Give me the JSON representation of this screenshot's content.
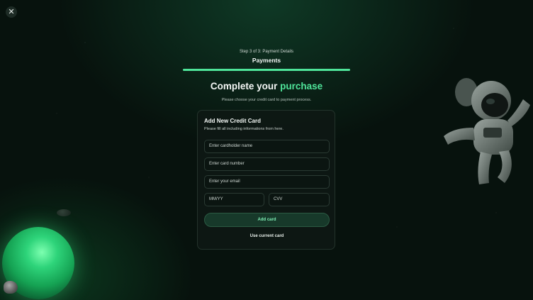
{
  "header": {
    "close_symbol": "✕",
    "step_text": "Step 3 of 3: Payment Details",
    "heading": "Payments",
    "progress_fraction": 1.0
  },
  "main": {
    "title_part1": "Complete your ",
    "title_accent": "purchase",
    "subtitle": "Please choose your credit card to payment process."
  },
  "card": {
    "title": "Add New Credit Card",
    "description": "Please fill all including informations from here.",
    "fields": {
      "cardholder_placeholder": "Enter cardholder name",
      "card_number_placeholder": "Enter card number",
      "email_placeholder": "Enter your email",
      "expiry_placeholder": "MM/YY",
      "cvv_placeholder": "CVV"
    },
    "add_button": "Add card",
    "use_current": "Use current card"
  },
  "colors": {
    "accent": "#4fe59a",
    "background": "#07120d"
  },
  "icons": {
    "close": "close-icon"
  }
}
